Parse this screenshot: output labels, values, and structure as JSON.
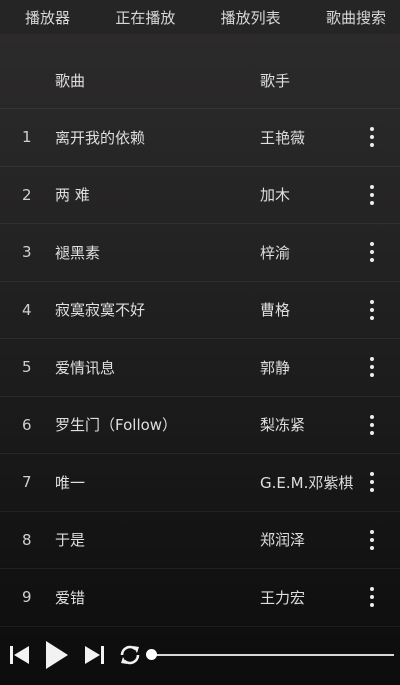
{
  "tabs": [
    {
      "label": "播放器"
    },
    {
      "label": "正在播放"
    },
    {
      "label": "播放列表"
    },
    {
      "label": "歌曲搜索"
    }
  ],
  "header": {
    "title": "歌曲",
    "artist": "歌手"
  },
  "songs": [
    {
      "index": "1",
      "title": "离开我的依赖",
      "artist": "王艳薇"
    },
    {
      "index": "2",
      "title": "两 难",
      "artist": "加木"
    },
    {
      "index": "3",
      "title": "褪黑素",
      "artist": "梓渝"
    },
    {
      "index": "4",
      "title": "寂寞寂寞不好",
      "artist": "曹格"
    },
    {
      "index": "5",
      "title": "爱情讯息",
      "artist": "郭静"
    },
    {
      "index": "6",
      "title": "罗生门（Follow）",
      "artist": "梨冻紧"
    },
    {
      "index": "7",
      "title": "唯一",
      "artist": "G.E.M.邓紫棋"
    },
    {
      "index": "8",
      "title": "于是",
      "artist": "郑润泽"
    },
    {
      "index": "9",
      "title": "爱错",
      "artist": "王力宏"
    }
  ],
  "player": {
    "progress": 0.0,
    "icons": [
      "skip-previous-icon",
      "play-icon",
      "skip-next-icon",
      "repeat-icon",
      "more-vertical-icon"
    ]
  }
}
